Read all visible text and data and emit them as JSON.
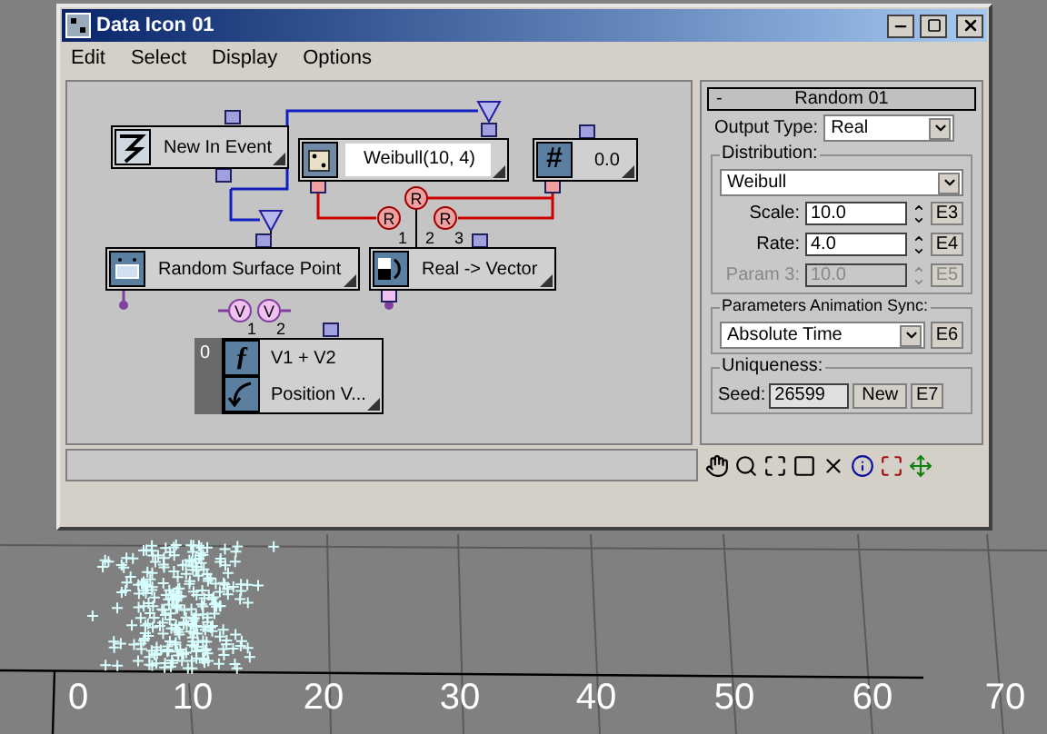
{
  "window": {
    "title": "Data Icon 01"
  },
  "menu": [
    "Edit",
    "Select",
    "Display",
    "Options"
  ],
  "nodes": [
    {
      "kind": "event",
      "label": "New In Event"
    },
    {
      "kind": "operator",
      "label": "Weibull(10, 4)"
    },
    {
      "kind": "constant",
      "label": "0.0",
      "glyph": "#"
    },
    {
      "kind": "surface",
      "label": "Random Surface Point"
    },
    {
      "kind": "converter",
      "label": "Real -> Vector",
      "inputs": [
        {
          "label": "1",
          "badge": "R"
        },
        {
          "label": "2",
          "badge": "R"
        },
        {
          "label": "3",
          "badge": "R"
        }
      ]
    },
    {
      "kind": "stack",
      "index": "0",
      "rows": [
        {
          "kind": "function",
          "label": "V1 + V2",
          "glyph": "ƒ"
        },
        {
          "kind": "output",
          "label": "Position V..."
        }
      ],
      "inputs": [
        {
          "label": "1",
          "badge": "V"
        },
        {
          "label": "2",
          "badge": "V"
        }
      ]
    }
  ],
  "panel": {
    "collapse": "-",
    "title": "Random 01",
    "output_type": {
      "label": "Output Type:",
      "value": "Real"
    },
    "distribution": {
      "label": "Distribution:",
      "value": "Weibull",
      "params": [
        {
          "label": "Scale:",
          "value": "10.0",
          "button": "E3",
          "disabled": false
        },
        {
          "label": "Rate:",
          "value": "4.0",
          "button": "E4",
          "disabled": false
        },
        {
          "label": "Param 3:",
          "value": "10.0",
          "button": "E5",
          "disabled": true
        }
      ]
    },
    "sync": {
      "label": "Parameters Animation Sync:",
      "value": "Absolute Time",
      "button": "E6"
    },
    "uniqueness": {
      "label": "Uniqueness:",
      "seed_label": "Seed:",
      "seed": "26599",
      "new_button": "New",
      "button": "E7"
    }
  },
  "viewport": {
    "axis_labels": [
      "0",
      "10",
      "20",
      "30",
      "40",
      "50",
      "60",
      "70"
    ]
  }
}
